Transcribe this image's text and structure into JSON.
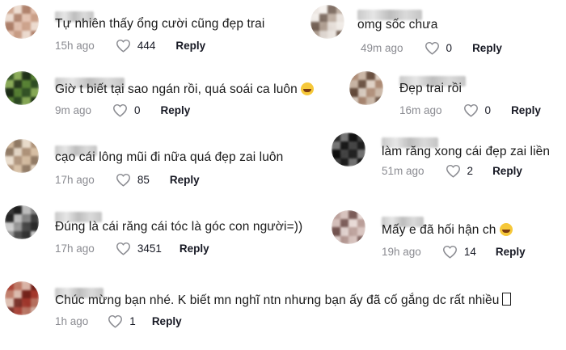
{
  "comments": [
    {
      "text": "Tự nhiên thấy ổng cười cũng đẹp trai",
      "time": "15h ago",
      "likes": "444",
      "reply": "Reply",
      "emoji": ""
    },
    {
      "text": "Giờ t biết tại sao ngán rồi, quá soái ca luôn",
      "time": "9m ago",
      "likes": "0",
      "reply": "Reply",
      "emoji": "grin"
    },
    {
      "text": "cạo cái lông mũi đi nữa quá đẹp zai luôn",
      "time": "17h ago",
      "likes": "85",
      "reply": "Reply",
      "emoji": ""
    },
    {
      "text": "Đúng là cái răng cái tóc là góc con người=))",
      "time": "17h ago",
      "likes": "3451",
      "reply": "Reply",
      "emoji": ""
    },
    {
      "text": "Chúc mừng bạn nhé. K biết mn nghĩ ntn nhưng bạn ấy đã cố gắng dc rất nhiều",
      "time": "1h ago",
      "likes": "1",
      "reply": "Reply",
      "emoji": "box"
    },
    {
      "text": "omg sốc chưa",
      "time": "49m ago",
      "likes": "0",
      "reply": "Reply",
      "emoji": ""
    },
    {
      "text": "Đẹp trai rồi",
      "time": "16m ago",
      "likes": "0",
      "reply": "Reply",
      "emoji": ""
    },
    {
      "text": "làm răng xong cái đẹp zai liền",
      "time": "51m ago",
      "likes": "2",
      "reply": "Reply",
      "emoji": ""
    },
    {
      "text": "Mấy e đã hối hận ch",
      "time": "19h ago",
      "likes": "14",
      "reply": "Reply",
      "emoji": "laugh"
    }
  ],
  "colors": {
    "meta_gray": "#8a8b91",
    "text": "#1a1a1a",
    "reply": "#161823"
  },
  "icons": {
    "like": "heart-outline-icon",
    "emoji_grin": "grinning-face-icon",
    "emoji_laugh": "tears-of-joy-icon"
  }
}
